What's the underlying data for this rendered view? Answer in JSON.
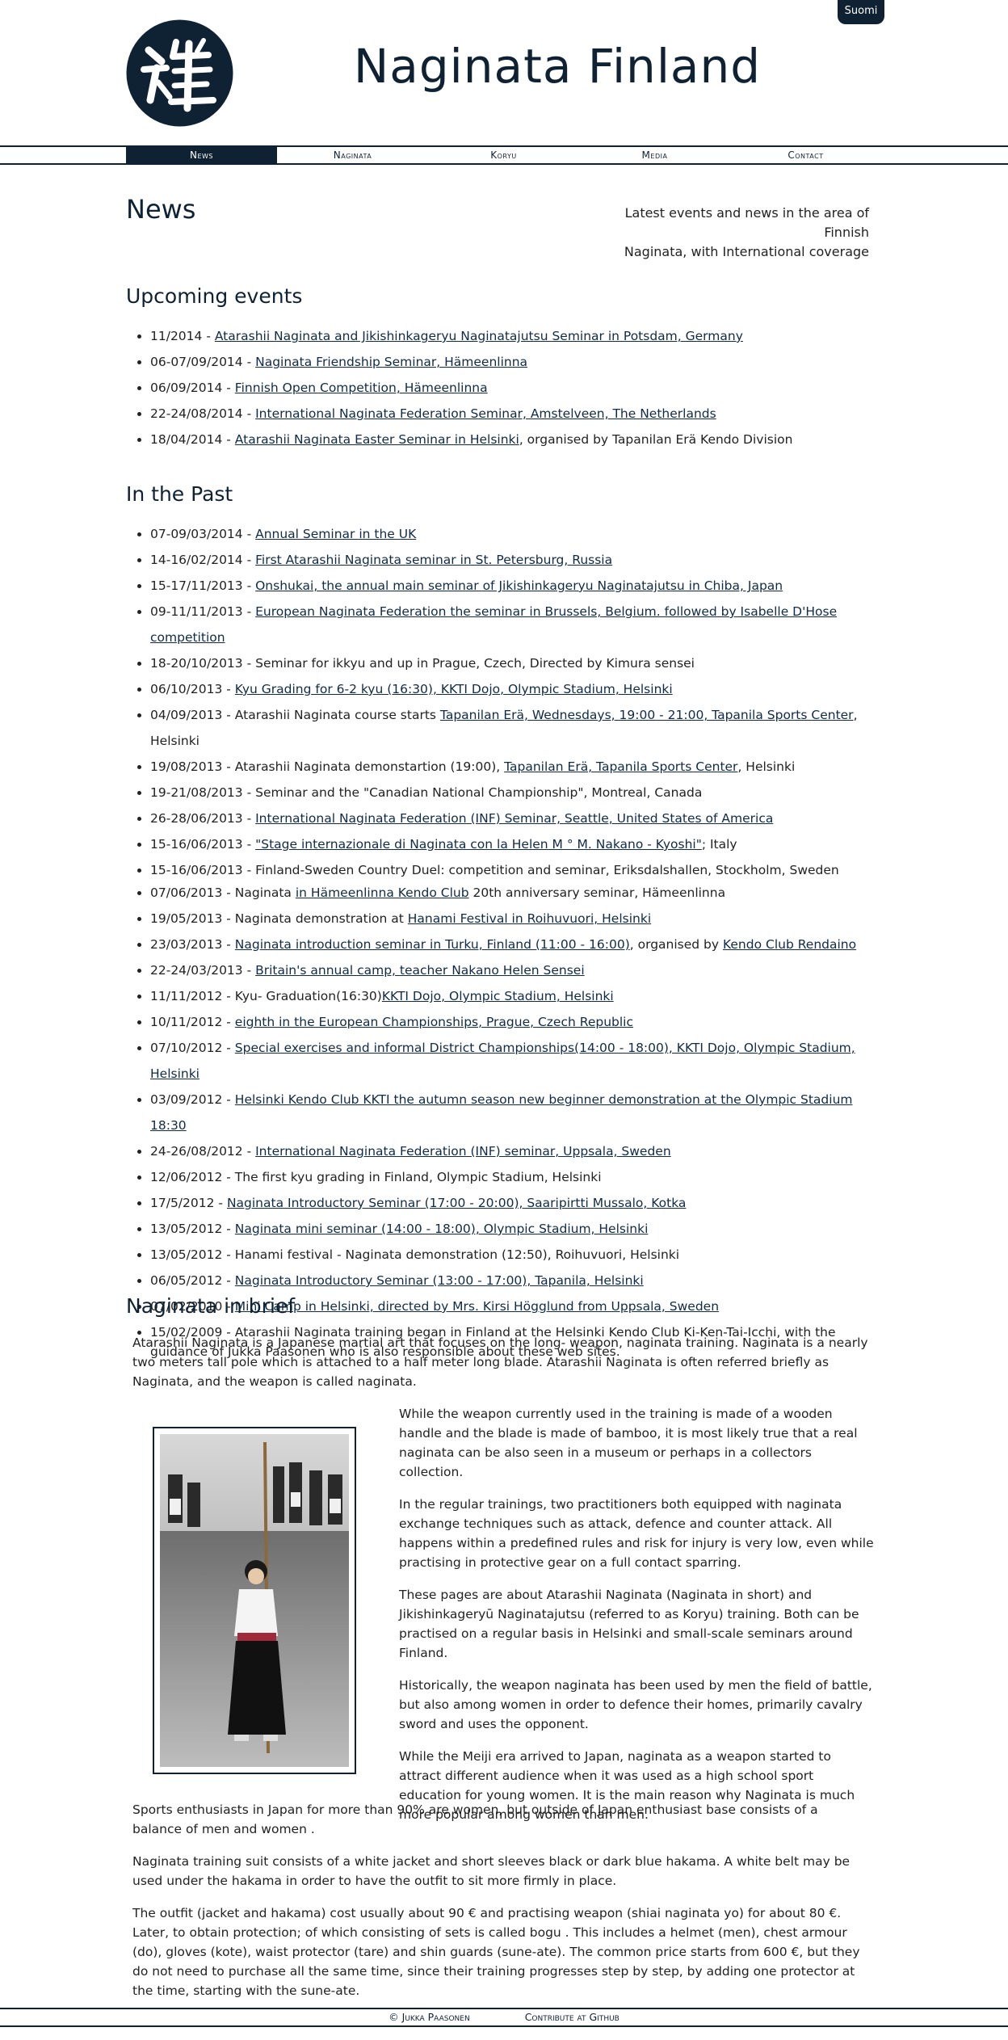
{
  "lang_button": "Suomi",
  "site_title": "Naginata Finland",
  "nav": [
    "News",
    "Naginata",
    "Koryu",
    "Media",
    "Contact"
  ],
  "page": {
    "title": "News",
    "tagline_line1": "Latest events and news in the area of Finnish",
    "tagline_line2": "Naginata, with International coverage"
  },
  "upcoming": {
    "heading": "Upcoming events",
    "items": [
      {
        "date": "11/2014 - ",
        "link": "Atarashii Naginata and Jikishinkageryu Naginatajutsu Seminar in Potsdam, Germany",
        "after": ""
      },
      {
        "date": "06-07/09/2014 - ",
        "link": "Naginata Friendship Seminar, Hämeenlinna",
        "after": ""
      },
      {
        "date": "06/09/2014 - ",
        "link": "Finnish Open Competition, Hämeenlinna",
        "after": ""
      },
      {
        "date": "22-24/08/2014 - ",
        "link": "International Naginata Federation Seminar, Amstelveen, The Netherlands",
        "after": ""
      },
      {
        "date": "18/04/2014 - ",
        "link": "Atarashii Naginata Easter Seminar in Helsinki",
        "after": ", organised by Tapanilan Erä Kendo Division"
      }
    ]
  },
  "past": {
    "heading": "In the Past",
    "items": [
      {
        "date": "07-09/03/2014 - ",
        "link": "Annual Seminar in the UK",
        "after": ""
      },
      {
        "date": "14-16/02/2014 - ",
        "link": "First Atarashii Naginata seminar in St. Petersburg, Russia",
        "after": ""
      },
      {
        "date": "15-17/11/2013 - ",
        "link": "Onshukai, the annual main seminar of Jikishinkageryu Naginatajutsu in Chiba, Japan",
        "after": ""
      },
      {
        "date": "09-11/11/2013 - ",
        "link": "European Naginata Federation the seminar in Brussels, Belgium. followed by Isabelle D'Hose competition",
        "after": ""
      },
      {
        "date": "18-20/10/2013 - Seminar for ikkyu and up in Prague, Czech, Directed by Kimura sensei",
        "link": "",
        "after": ""
      },
      {
        "date": "06/10/2013 - ",
        "link": "Kyu Grading for 6-2 kyu (16:30), KKTI Dojo, Olympic Stadium, Helsinki",
        "after": ""
      },
      {
        "date": "04/09/2013 - Atarashii Naginata course starts ",
        "link": "Tapanilan Erä, Wednesdays, 19:00 - 21:00, Tapanila Sports Center",
        "after": ", Helsinki"
      },
      {
        "date": "19/08/2013 - Atarashii Naginata demonstartion (19:00), ",
        "link": "Tapanilan Erä, Tapanila Sports Center",
        "after": ", Helsinki"
      },
      {
        "date": "19-21/08/2013 - Seminar and the \"Canadian National Championship\", Montreal, Canada",
        "link": "",
        "after": ""
      },
      {
        "date": "26-28/06/2013 - ",
        "link": "International Naginata Federation (INF) Seminar, Seattle, United States of America",
        "after": ""
      },
      {
        "date": "15-16/06/2013 - ",
        "link": "\"Stage internazionale di Naginata con la Helen M ° M. Nakano - Kyoshi\"",
        "after": "; Italy"
      },
      {
        "date": "15-16/06/2013 - Finland-Sweden Country Duel: competition and seminar, Eriksdalshallen, Stockholm, Sweden",
        "link": "",
        "after": ""
      },
      {
        "date": "07/06/2013 - Naginata ",
        "link": "in Hämeenlinna Kendo Club",
        "after": " 20th anniversary seminar, Hämeenlinna"
      },
      {
        "date": "19/05/2013 - Naginata demonstration at ",
        "link": "Hanami Festival in Roihuvuori, Helsinki",
        "after": ""
      },
      {
        "date": "23/03/2013 - ",
        "link": "Naginata introduction seminar in Turku, Finland (11:00 - 16:00)",
        "after": ", organised by ",
        "link2": "Kendo Club Rendaino"
      },
      {
        "date": "22-24/03/2013 - ",
        "link": "Britain's annual camp, teacher Nakano Helen Sensei",
        "after": ""
      },
      {
        "date": "11/11/2012 - Kyu- Graduation(16:30)",
        "link": "KKTI Dojo, Olympic Stadium, Helsinki",
        "after": ""
      },
      {
        "date": "10/11/2012 - ",
        "link": "eighth in the European Championships, Prague, Czech Republic",
        "after": ""
      },
      {
        "date": "07/10/2012 - ",
        "link": "Special exercises and informal District Championships(14:00 - 18:00), KKTI Dojo, Olympic Stadium, Helsinki",
        "after": ""
      },
      {
        "date": "03/09/2012 - ",
        "link": "Helsinki Kendo Club KKTI the autumn season new beginner demonstration at the Olympic Stadium 18:30",
        "after": ""
      },
      {
        "date": "24-26/08/2012 - ",
        "link": "International Naginata Federation (INF) seminar, Uppsala, Sweden",
        "after": ""
      },
      {
        "date": "12/06/2012 - The first kyu grading in Finland, Olympic Stadium, Helsinki",
        "link": "",
        "after": ""
      },
      {
        "date": "17/5/2012 - ",
        "link": "Naginata Introductory Seminar (17:00 - 20:00), Saaripirtti Mussalo, Kotka",
        "after": ""
      },
      {
        "date": "13/05/2012 - ",
        "link": "Naginata mini seminar (14:00 - 18:00), Olympic Stadium, Helsinki",
        "after": ""
      },
      {
        "date": "13/05/2012 - Hanami festival - Naginata demonstration (12:50), Roihuvuori, Helsinki",
        "link": "",
        "after": ""
      },
      {
        "date": "06/05/2012 - ",
        "link": "Naginata Introductory Seminar (13:00 - 17:00), Tapanila, Helsinki",
        "after": ""
      },
      {
        "date": "07/02/2010 - ",
        "link": "Mini Camp in Helsinki, directed by Mrs. Kirsi Högglund from Uppsala, Sweden",
        "after": ""
      },
      {
        "date": "15/02/2009 - Atarashii Naginata training began in Finland at the Helsinki Kendo Club Ki-Ken-Tai-Icchi, with the guidance of Jukka Paasonen who is also responsible about these web sites.",
        "link": "",
        "after": ""
      }
    ]
  },
  "brief": {
    "heading": "Naginata in brief",
    "intro": "Atarashii Naginata is a Japanese martial art that focuses on the long- weapon, naginata training. Naginata is a nearly two meters tall pole which is attached to a half meter long blade. Atarashii Naginata is often referred briefly as Naginata, and the weapon is called naginata.",
    "side_paragraphs": [
      "While the weapon currently used in the training is made of a wooden handle and the blade is made of bamboo, it is most likely true that a real naginata can be also seen in a museum or perhaps in a collectors collection.",
      "In the regular trainings, two practitioners both equipped with naginata exchange techniques such as attack, defence and counter attack. All happens within a predefined rules and risk for injury is very low, even while practising in protective gear on a full contact sparring.",
      "These pages are about Atarashii Naginata (Naginata in short) and Jikishinkageryū Naginatajutsu (referred to as Koryu) training. Both can be practised on a regular basis in Helsinki and small-scale seminars around Finland.",
      "Historically, the weapon naginata has been used by men the field of battle, but also among women in order to defence their homes, primarily cavalry sword and uses the opponent.",
      "While the Meiji era arrived to Japan, naginata as a weapon started to attract different audience when it was used as a high school sport education for young women. It is the main reason why Naginata is much more popular among women than men."
    ],
    "after_paragraphs": [
      "Sports enthusiasts in Japan for more than 90% are women, but outside of Japan enthusiast base consists of a balance of men and women .",
      "Naginata training suit consists of a white jacket and short sleeves black or dark blue hakama. A white belt may be used under the hakama in order to have the outfit to sit more firmly in place.",
      "The outfit (jacket and hakama) cost usually about 90 € and practising weapon (shiai naginata yo) for about 80 €. Later, to obtain protection; of which consisting of sets is called bogu . This includes a helmet (men), chest armour (do), gloves (kote), waist protector (tare) and shin guards (sune-ate). The common price starts from 600 €, but they do not need to purchase all the same time, since their training progresses step by step, by adding one protector at the time, starting with the sune-ate."
    ]
  },
  "footer": {
    "author": "© Jukka Paasonen",
    "github": "Contribute at Github"
  },
  "colors": {
    "navy": "#0f2233",
    "link": "#102b47"
  }
}
